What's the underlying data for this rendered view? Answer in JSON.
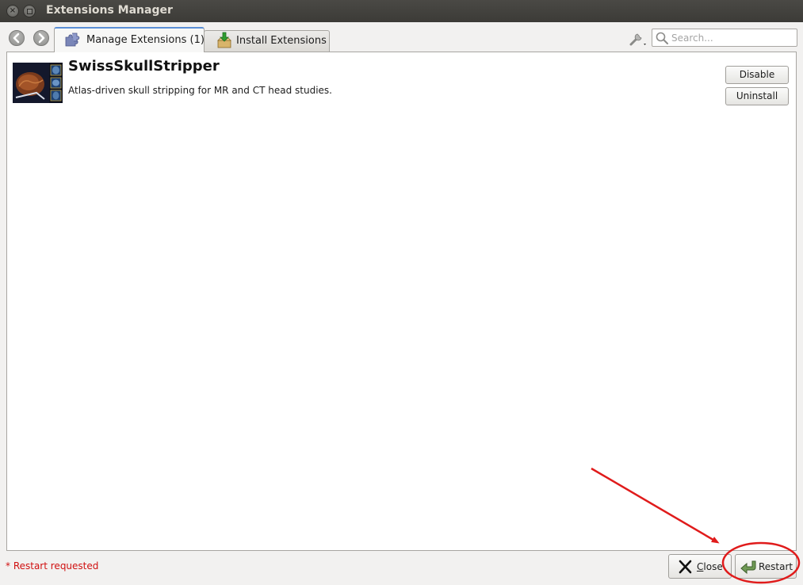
{
  "window": {
    "title": "Extensions Manager"
  },
  "tabs": [
    {
      "label": "Manage Extensions (1)",
      "icon": "puzzle-icon",
      "active": true
    },
    {
      "label": "Install Extensions",
      "icon": "download-box-icon",
      "active": false
    }
  ],
  "search": {
    "placeholder": "Search...",
    "value": ""
  },
  "extensions": [
    {
      "name": "SwissSkullStripper",
      "description": "Atlas-driven skull stripping for MR and CT head studies.",
      "buttons": {
        "disable": "Disable",
        "uninstall": "Uninstall"
      }
    }
  ],
  "footer": {
    "status": "* Restart requested",
    "close_first": "C",
    "close_rest": "lose",
    "restart": "Restart"
  },
  "colors": {
    "accent_tab": "#5b8fd6",
    "status_text": "#d01010",
    "annotation": "#e01b1b"
  }
}
